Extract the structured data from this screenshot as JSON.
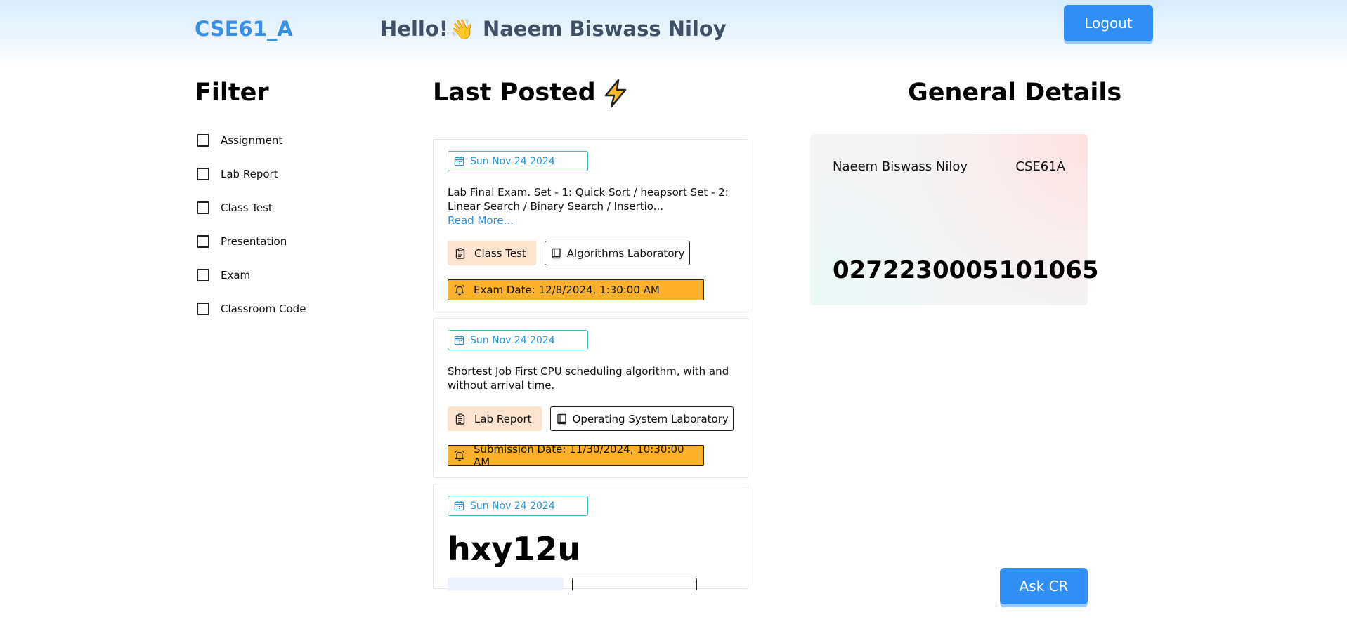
{
  "header": {
    "brand": "CSE61_A",
    "greeting": "Hello!",
    "wave_emoji": "👋",
    "user_name": "Naeem Biswass Niloy",
    "logout_label": "Logout"
  },
  "filter": {
    "title": "Filter",
    "items": [
      {
        "label": "Assignment",
        "checked": false
      },
      {
        "label": "Lab Report",
        "checked": false
      },
      {
        "label": "Class Test",
        "checked": false
      },
      {
        "label": "Presentation",
        "checked": false
      },
      {
        "label": "Exam",
        "checked": false
      },
      {
        "label": "Classroom Code",
        "checked": false
      }
    ]
  },
  "feed": {
    "title": "Last Posted",
    "posts": [
      {
        "date": "Sun Nov 24 2024",
        "description": "Lab Final Exam. Set - 1: Quick Sort / heapsort Set - 2: Linear Search / Binary Search / Insertio...",
        "read_more": "Read More...",
        "type": "Class Test",
        "course": "Algorithms Laboratory",
        "deadline": "Exam Date: 12/8/2024, 1:30:00 AM"
      },
      {
        "date": "Sun Nov 24 2024",
        "description": "Shortest Job First CPU scheduling algorithm, with and without arrival time.",
        "type": "Lab Report",
        "course": "Operating System Laboratory",
        "deadline": "Submission Date: 11/30/2024, 10:30:00 AM"
      },
      {
        "date": "Sun Nov 24 2024",
        "code": "hxy12u"
      }
    ]
  },
  "general": {
    "title": "General Details",
    "name": "Naeem Biswass Niloy",
    "section": "CSE61A",
    "student_id": "0272230005101065"
  },
  "ask_cr_label": "Ask CR",
  "colors": {
    "accent_blue": "#2f8ff5",
    "deadline_amber": "#fdb12b",
    "type_tag_peach": "#fde4cf"
  }
}
